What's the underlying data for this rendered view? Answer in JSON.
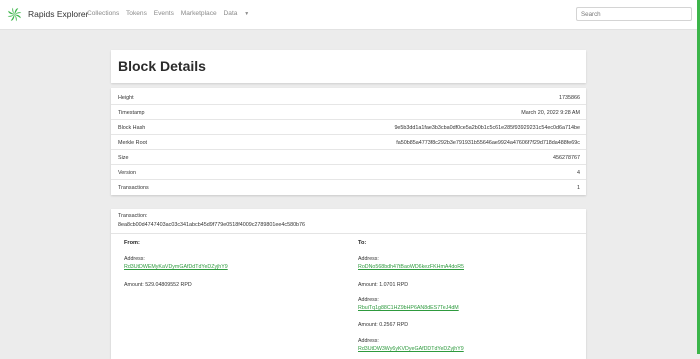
{
  "nav": {
    "brand": "Rapids Explorer",
    "links": [
      "Collections",
      "Tokens",
      "Events",
      "Marketplace"
    ],
    "dropdown": "Data",
    "search_placeholder": "Search",
    "colors": {
      "accent": "#3cb54a",
      "link": "#2e9a3e"
    },
    "logo_icon": "rapids-pinwheel-icon",
    "caret_icon": "caret-down-icon"
  },
  "page": {
    "title": "Block Details"
  },
  "details": [
    {
      "label": "Height",
      "value": "1735866"
    },
    {
      "label": "Timestamp",
      "value": "March 20, 2022 9:28 AM"
    },
    {
      "label": "Block Hash",
      "value": "9e5b3dd1a1fae3b3cba0df0ce5a2b0b1c5c61e285f93929231c54ec0d6a714be"
    },
    {
      "label": "Merkle Root",
      "value": "fa50b85a4773f8c292b3e791931b55646ae9924a47606f7f29d718da488fe69c"
    },
    {
      "label": "Size",
      "value": "456278767"
    },
    {
      "label": "Version",
      "value": "4"
    },
    {
      "label": "Transactions",
      "value": "1"
    }
  ],
  "transaction": {
    "label": "Transaction:",
    "hash": "8ea8cb00d4747403ac03c341abcb45d9f779e0518f4009c2789801ee4c580b76",
    "from_heading": "From:",
    "to_heading": "To:",
    "from": [
      {
        "address_label": "Address:",
        "address": "Rd3UtDWEMyKaVDymGAfDdTdYeDZyjhY9",
        "amount": "Amount: 529.04809552 RPD"
      }
    ],
    "to": [
      {
        "address_label": "Address:",
        "address": "RoDNo568bdh47tBaoWD6kezFKHmA4doR5",
        "amount": "Amount: 1.0701 RPD"
      },
      {
        "address_label": "Address:",
        "address": "RbuiTq1g88C1HZ9bHP6AN8dES7TeJ4dM",
        "amount": "Amount: 0.2567 RPD"
      },
      {
        "address_label": "Address:",
        "address": "Rd3UtDW3Wy6yKVDyeGAfDDTdYeDZyjhY9",
        "amount": ""
      }
    ]
  }
}
